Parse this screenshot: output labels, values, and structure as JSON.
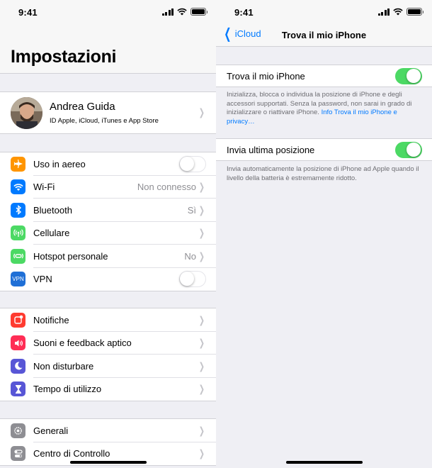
{
  "left": {
    "status": {
      "time": "9:41"
    },
    "title": "Impostazioni",
    "profile": {
      "name": "Andrea Guida",
      "subtitle": "ID Apple, iCloud, iTunes e App Store"
    },
    "group1": [
      {
        "label": "Uso in aereo",
        "icon": "airplane-icon",
        "color": "#ff9500",
        "control": "toggle",
        "on": false
      },
      {
        "label": "Wi-Fi",
        "icon": "wifi-icon",
        "color": "#007aff",
        "value": "Non connesso"
      },
      {
        "label": "Bluetooth",
        "icon": "bluetooth-icon",
        "color": "#007aff",
        "value": "Sì"
      },
      {
        "label": "Cellulare",
        "icon": "cellular-icon",
        "color": "#4cd964"
      },
      {
        "label": "Hotspot personale",
        "icon": "hotspot-icon",
        "color": "#4cd964",
        "value": "No"
      },
      {
        "label": "VPN",
        "icon": "vpn-icon",
        "icon_text": "VPN",
        "color": "#1f6fd6",
        "control": "toggle",
        "on": false
      }
    ],
    "group2": [
      {
        "label": "Notifiche",
        "icon": "notifications-icon",
        "color": "#ff3b30"
      },
      {
        "label": "Suoni e feedback aptico",
        "icon": "sounds-icon",
        "color": "#ff2d55"
      },
      {
        "label": "Non disturbare",
        "icon": "moon-icon",
        "color": "#5856d6"
      },
      {
        "label": "Tempo di utilizzo",
        "icon": "hourglass-icon",
        "color": "#5856d6"
      }
    ],
    "group3": [
      {
        "label": "Generali",
        "icon": "gear-icon",
        "color": "#8e8e93"
      },
      {
        "label": "Centro di Controllo",
        "icon": "control-center-icon",
        "color": "#8e8e93"
      }
    ]
  },
  "right": {
    "status": {
      "time": "9:41"
    },
    "back_label": "iCloud",
    "title": "Trova il mio iPhone",
    "find_iphone": {
      "label": "Trova il mio iPhone",
      "on": true,
      "description": "Inizializza, blocca o individua la posizione di iPhone e degli accessori supportati. Senza la password, non sarai in grado di inizializzare o riattivare iPhone. ",
      "link": "Info Trova il mio iPhone e privacy…"
    },
    "send_last_location": {
      "label": "Invia ultima posizione",
      "on": true,
      "description": "Invia automaticamente la posizione di iPhone ad Apple quando il livello della batteria è estremamente ridotto."
    }
  },
  "colors": {
    "accent": "#007aff",
    "toggle_on": "#4cd964",
    "background": "#efeff4"
  }
}
